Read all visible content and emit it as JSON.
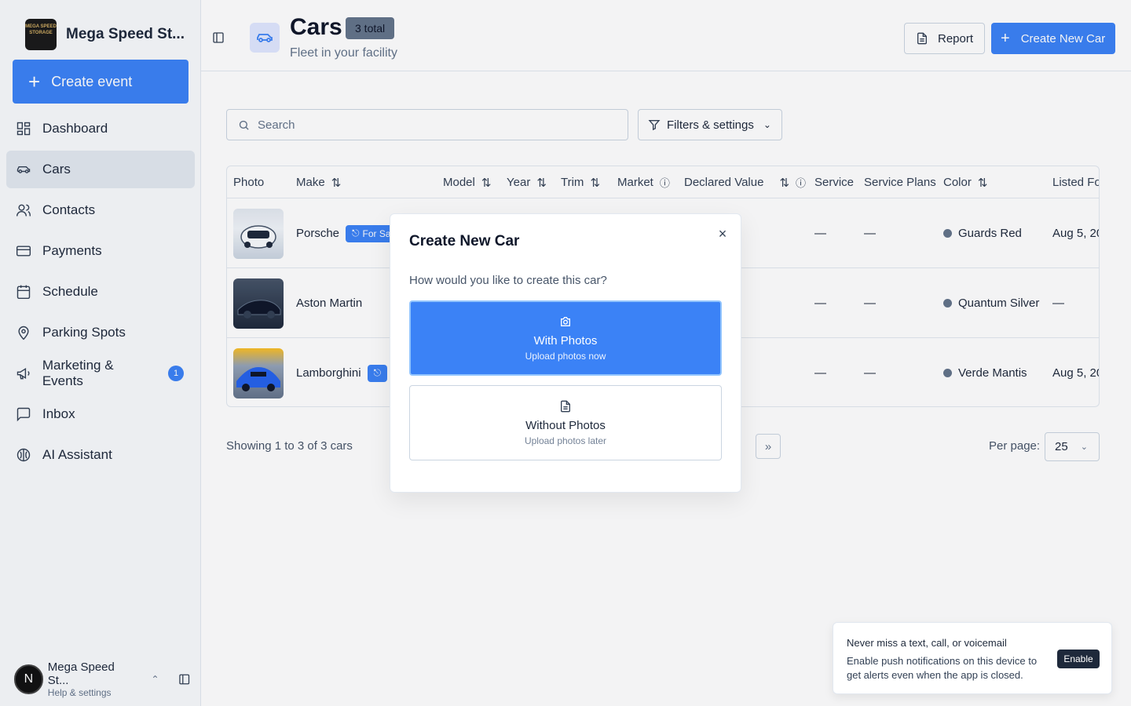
{
  "brand": {
    "name": "Mega Speed St...",
    "logo_text": "MEGA SPEED STORAGE"
  },
  "sidebar": {
    "create_event_label": "Create event",
    "items": [
      {
        "label": "Dashboard",
        "icon": "dashboard-icon"
      },
      {
        "label": "Cars",
        "icon": "car-icon",
        "active": true
      },
      {
        "label": "Contacts",
        "icon": "contacts-icon"
      },
      {
        "label": "Payments",
        "icon": "payments-icon"
      },
      {
        "label": "Schedule",
        "icon": "calendar-icon"
      },
      {
        "label": "Parking Spots",
        "icon": "map-pin-icon"
      },
      {
        "label": "Marketing & Events",
        "icon": "megaphone-icon",
        "badge": "1"
      },
      {
        "label": "Inbox",
        "icon": "inbox-icon"
      },
      {
        "label": "AI Assistant",
        "icon": "ai-icon"
      }
    ],
    "user": {
      "initial": "N",
      "name": "Mega Speed St...",
      "sub": "Help & settings"
    }
  },
  "header": {
    "title": "Cars",
    "count_badge": "3 total",
    "subtitle": "Fleet in your facility",
    "report_label": "Report",
    "create_label": "Create New Car"
  },
  "toolbar": {
    "search_placeholder": "Search",
    "filters_label": "Filters & settings"
  },
  "table": {
    "columns": [
      "Photo",
      "Make",
      "Model",
      "Year",
      "Trim",
      "Market",
      "Declared Value",
      "Service",
      "Service Plans",
      "Color",
      "Listed Fo"
    ],
    "rows": [
      {
        "make": "Porsche",
        "tag": "For Sa",
        "service": "—",
        "service_plans": "—",
        "color": "Guards Red",
        "listed": "Aug 5, 20"
      },
      {
        "make": "Aston Martin",
        "tag": "",
        "service": "—",
        "service_plans": "—",
        "color": "Quantum Silver",
        "listed": "—"
      },
      {
        "make": "Lamborghini",
        "tag": "",
        "service": "—",
        "service_plans": "—",
        "color": "Verde Mantis",
        "listed": "Aug 5, 20"
      }
    ]
  },
  "footer": {
    "showing": "Showing 1 to 3 of 3 cars",
    "last_page": "»",
    "per_page_label": "Per page:",
    "per_page_value": "25"
  },
  "modal": {
    "title": "Create New Car",
    "question": "How would you like to create this car?",
    "with_photos": {
      "title": "With Photos",
      "sub": "Upload photos now"
    },
    "without_photos": {
      "title": "Without Photos",
      "sub": "Upload photos later"
    }
  },
  "toast": {
    "title": "Never miss a text, call, or voicemail",
    "body": "Enable push notifications on this device to get alerts even when the app is closed.",
    "button": "Enable"
  },
  "colors": {
    "accent": "#3b82f6",
    "badge_bg": "#64748b"
  }
}
